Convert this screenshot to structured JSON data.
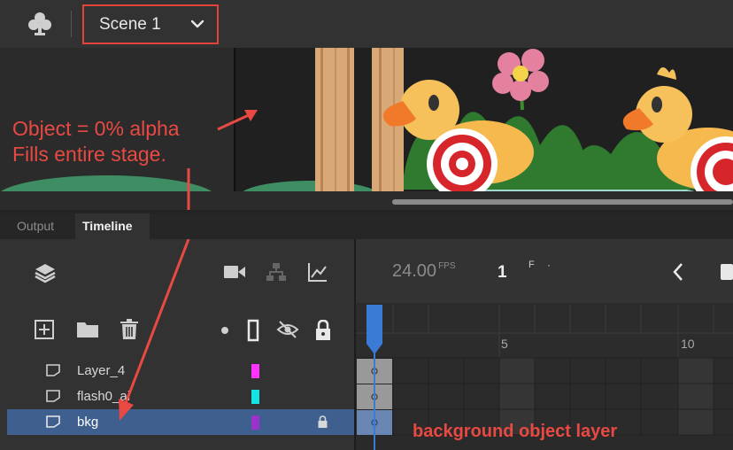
{
  "toolbar": {
    "scene_label": "Scene 1",
    "scene_icon": "club-icon",
    "scene_dropdown_icon": "chevron-down-icon"
  },
  "stage": {
    "note_line1": "Object = 0% alpha",
    "note_line2": "Fills entire stage."
  },
  "panel_tabs": [
    {
      "label": "Output",
      "active": false
    },
    {
      "label": "Timeline",
      "active": true
    }
  ],
  "timeline": {
    "fps_value": "24.00",
    "fps_unit": "FPS",
    "current_frame": "1",
    "frame_unit": "F",
    "frame_separator": "·",
    "ruler_labels": [
      "5",
      "10"
    ],
    "layers": [
      {
        "name": "Layer_4",
        "color": "#ff33ff",
        "locked": false,
        "selected": false
      },
      {
        "name": "flash0_ai",
        "color": "#14e3e3",
        "locked": false,
        "selected": false
      },
      {
        "name": "bkg",
        "color": "#9933cc",
        "locked": true,
        "selected": true
      }
    ]
  },
  "annotation": {
    "text": "background object layer"
  },
  "colors": {
    "annotation_red": "#e84a43",
    "selection_blue": "#3f5f8f",
    "playhead_blue": "#3a7bd5"
  }
}
